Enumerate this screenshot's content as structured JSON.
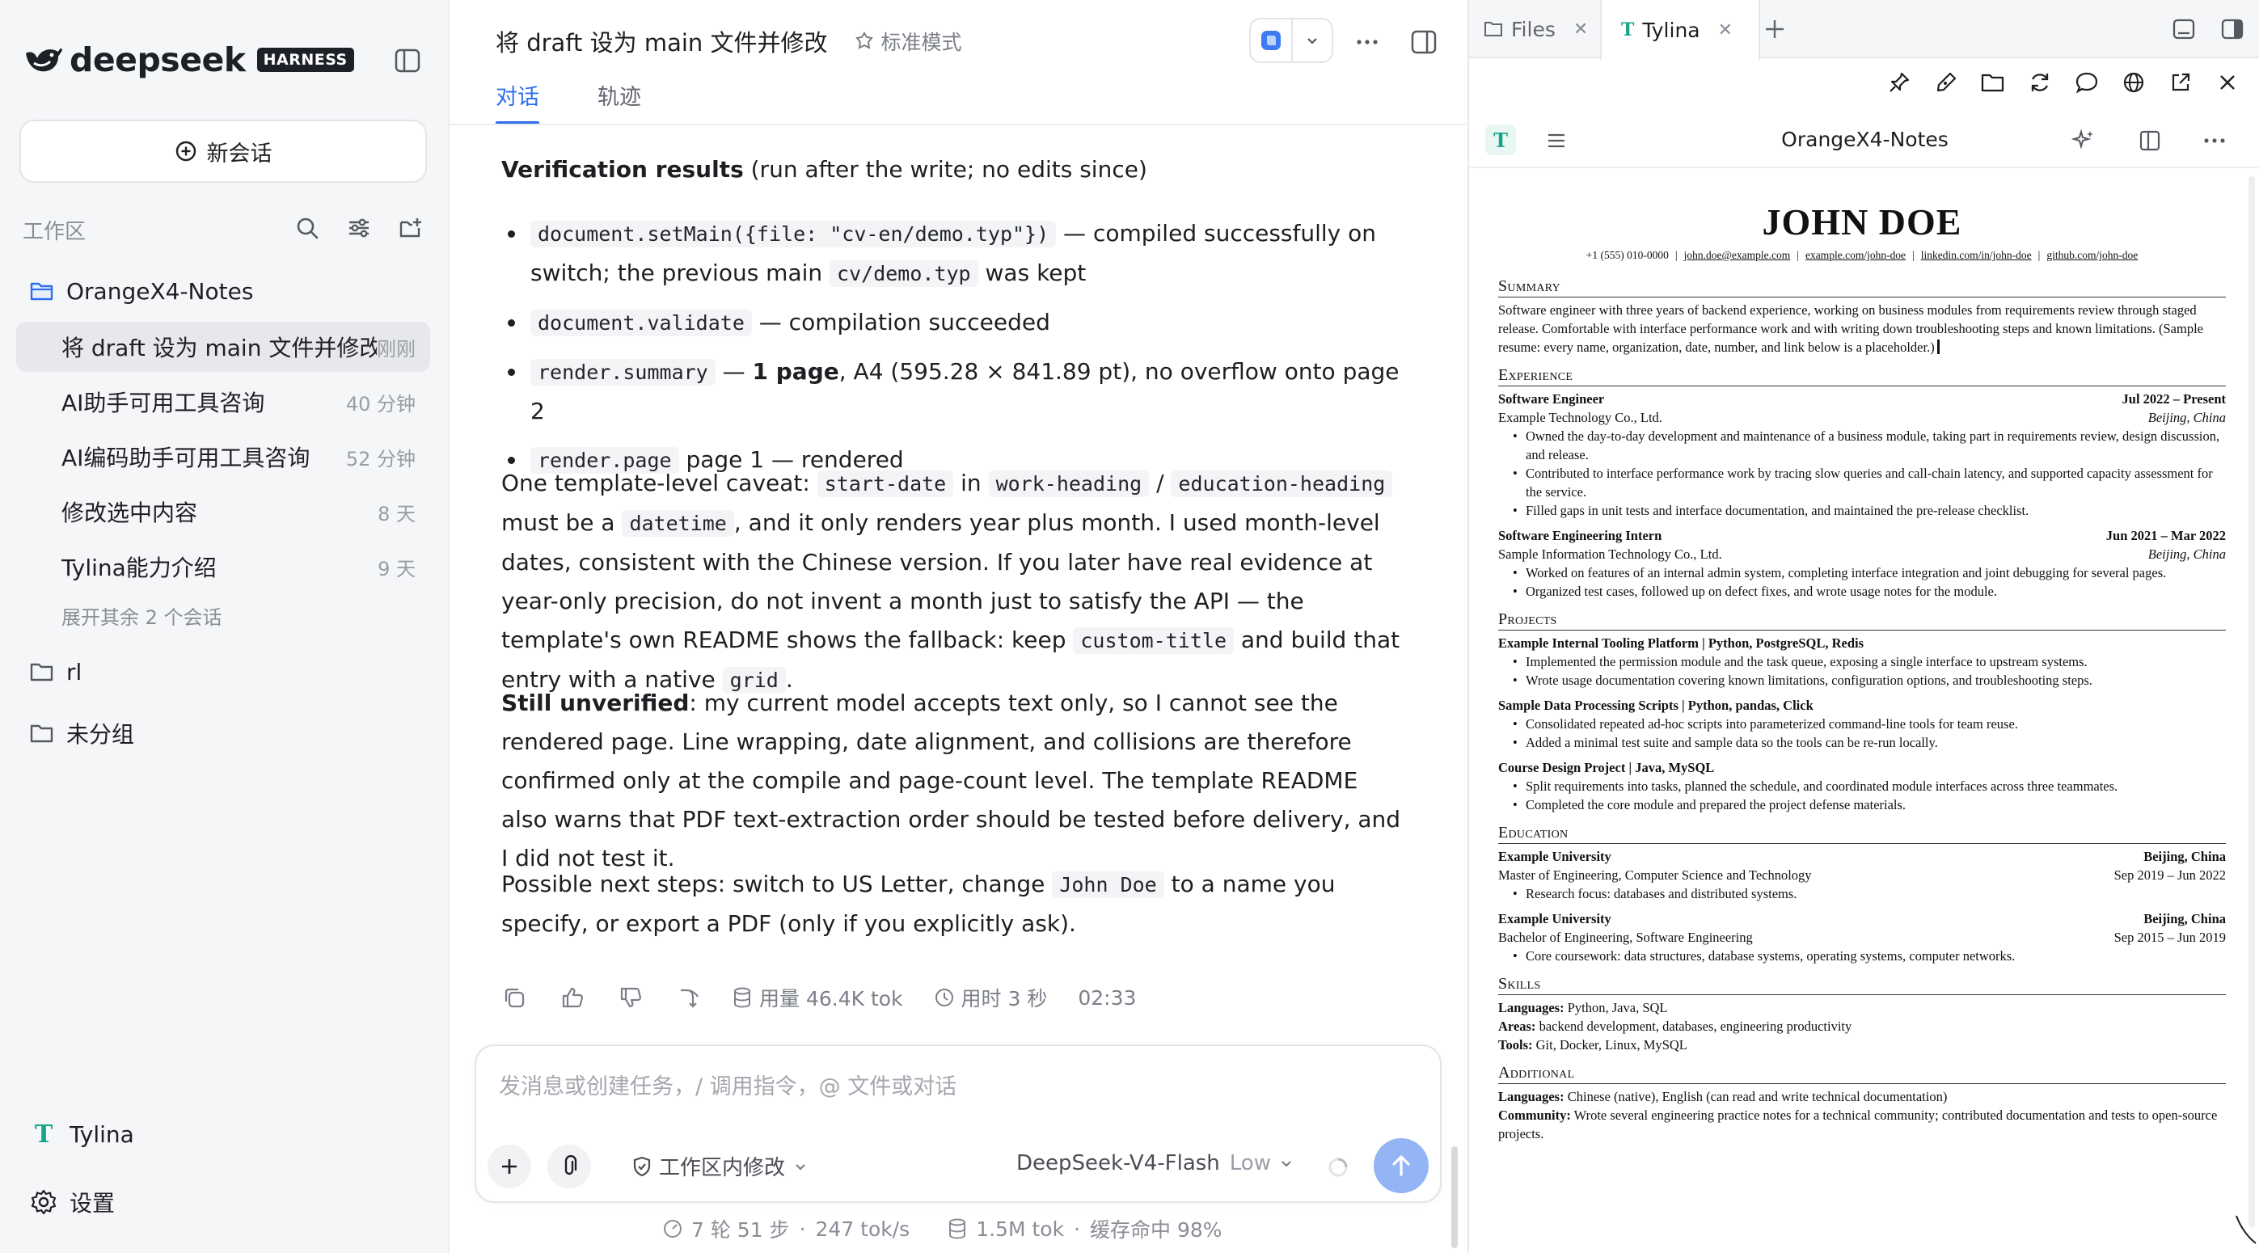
{
  "sidebar": {
    "brand": "deepseek",
    "badge": "HARNESS",
    "new_chat": "新会话",
    "workspace_label": "工作区",
    "project": "OrangeX4-Notes",
    "conversations": [
      {
        "title": "将 draft 设为 main 文件并修改",
        "time": "刚刚"
      },
      {
        "title": "AI助手可用工具咨询",
        "time": "40 分钟"
      },
      {
        "title": "AI编码助手可用工具咨询",
        "time": "52 分钟"
      },
      {
        "title": "修改选中内容",
        "time": "8 天"
      },
      {
        "title": "Tylina能力介绍",
        "time": "9 天"
      }
    ],
    "expand_more": "展开其余 2 个会话",
    "folders": [
      "rl",
      "未分组"
    ],
    "app_name": "Tylina",
    "app_glyph": "T",
    "settings": "设置"
  },
  "main": {
    "title": "将 draft 设为 main 文件并修改",
    "mode": "标准模式",
    "tabs": [
      "对话",
      "轨迹"
    ],
    "msg": {
      "verif_bold": "Verification results",
      "verif_rest": " (run after the write; no edits since)",
      "b1_code1": "document.setMain({file: \"cv-en/demo.typ\"})",
      "b1_text1": " — compiled successfully on switch; the previous main ",
      "b1_code2": "cv/demo.typ",
      "b1_text2": " was kept",
      "b2_code": "document.validate",
      "b2_text": " — compilation succeeded",
      "b3_code": "render.summary",
      "b3_text1": " — ",
      "b3_bold": "1 page",
      "b3_text2": ", A4 (595.28 × 841.89 pt), no overflow onto page 2",
      "b4_code": "render.page",
      "b4_text": " page 1 — rendered",
      "p2_t1": "One template-level caveat: ",
      "p2_c1": "start-date",
      "p2_t2": " in ",
      "p2_c2": "work-heading",
      "p2_t3": " / ",
      "p2_c3": "education-heading",
      "p2_t4": " must be a ",
      "p2_c4": "datetime",
      "p2_t5": ", and it only renders year plus month. I used month-level dates, consistent with the Chinese version. If you later have real evidence at year-only precision, do not invent a month just to satisfy the API — the template's own README shows the fallback: keep ",
      "p2_c5": "custom-title",
      "p2_t6": " and build that entry with a native ",
      "p2_c6": "grid",
      "p2_t7": ".",
      "p3_bold": "Still unverified",
      "p3_rest": ": my current model accepts text only, so I cannot see the rendered page. Line wrapping, date alignment, and collisions are therefore confirmed only at the compile and page-count level. The template README also warns that PDF text-extraction order should be tested before delivery, and I did not test it.",
      "p4_t1": "Possible next steps: switch to US Letter, change ",
      "p4_c1": "John Doe",
      "p4_t2": " to a name you specify, or export a PDF (only if you explicitly ask)."
    },
    "meta": {
      "usage": "用量 46.4K tok",
      "duration": "用时 3 秒",
      "time": "02:33"
    },
    "composer": {
      "placeholder": "发消息或创建任务，/ 调用指令，@ 文件或对话",
      "scope": "工作区内修改",
      "model": "DeepSeek-V4-Flash",
      "level": "Low"
    },
    "footer": {
      "steps": "7 轮 51 步",
      "speed": "247 tok/s",
      "tokens": "1.5M tok",
      "cache": "缓存命中 98%"
    }
  },
  "right": {
    "tabs": [
      {
        "label": "Files"
      },
      {
        "label": "Tylina"
      }
    ],
    "doc_title": "OrangeX4-Notes",
    "resume": {
      "name": "JOHN DOE",
      "contacts": [
        "+1 (555) 010-0000",
        "john.doe@example.com",
        "example.com/john-doe",
        "linkedin.com/in/john-doe",
        "github.com/john-doe"
      ],
      "summary_h": "Summary",
      "summary": "Software engineer with three years of backend experience, working on business modules from requirements review through staged release. Comfortable with interface performance work and with writing down troubleshooting steps and known limitations. (Sample resume: every name, organization, date, number, and link below is a placeholder.)",
      "experience_h": "Experience",
      "exp1": {
        "role": "Software Engineer",
        "dates": "Jul 2022 – Present",
        "org": "Example Technology Co., Ltd.",
        "loc": "Beijing, China",
        "items": [
          "Owned the day-to-day development and maintenance of a business module, taking part in requirements review, design discussion, and release.",
          "Contributed to interface performance work by tracing slow queries and call-chain latency, and supported capacity assessment for the service.",
          "Filled gaps in unit tests and interface documentation, and maintained the pre-release checklist."
        ]
      },
      "exp2": {
        "role": "Software Engineering Intern",
        "dates": "Jun 2021 – Mar 2022",
        "org": "Sample Information Technology Co., Ltd.",
        "loc": "Beijing, China",
        "items": [
          "Worked on features of an internal admin system, completing interface integration and joint debugging for several pages.",
          "Organized test cases, followed up on defect fixes, and wrote usage notes for the module."
        ]
      },
      "projects_h": "Projects",
      "proj1": {
        "name": "Example Internal Tooling Platform",
        "stack": " | Python, PostgreSQL, Redis",
        "items": [
          "Implemented the permission module and the task queue, exposing a single interface to upstream systems.",
          "Wrote usage documentation covering known limitations, configuration options, and troubleshooting steps."
        ]
      },
      "proj2": {
        "name": "Sample Data Processing Scripts",
        "stack": " | Python, pandas, Click",
        "items": [
          "Consolidated repeated ad-hoc scripts into parameterized command-line tools for team reuse.",
          "Added a minimal test suite and sample data so the tools can be re-run locally."
        ]
      },
      "proj3": {
        "name": "Course Design Project",
        "stack": " | Java, MySQL",
        "items": [
          "Split requirements into tasks, planned the schedule, and coordinated module interfaces across three teammates.",
          "Completed the core module and prepared the project defense materials."
        ]
      },
      "education_h": "Education",
      "edu1": {
        "school": "Example University",
        "loc": "Beijing, China",
        "degree": "Master of Engineering, Computer Science and Technology",
        "dates": "Sep 2019 – Jun 2022",
        "item": "Research focus: databases and distributed systems."
      },
      "edu2": {
        "school": "Example University",
        "loc": "Beijing, China",
        "degree": "Bachelor of Engineering, Software Engineering",
        "dates": "Sep 2015 – Jun 2019",
        "item": "Core coursework: data structures, database systems, operating systems, computer networks."
      },
      "skills_h": "Skills",
      "skills": [
        {
          "k": "Languages:",
          "v": " Python, Java, SQL"
        },
        {
          "k": "Areas:",
          "v": " backend development, databases, engineering productivity"
        },
        {
          "k": "Tools:",
          "v": " Git, Docker, Linux, MySQL"
        }
      ],
      "additional_h": "Additional",
      "additional": [
        {
          "k": "Languages:",
          "v": " Chinese (native), English (can read and write technical documentation)"
        },
        {
          "k": "Community:",
          "v": " Wrote several engineering practice notes for a technical community; contributed documentation and tests to open-source projects."
        }
      ]
    }
  }
}
